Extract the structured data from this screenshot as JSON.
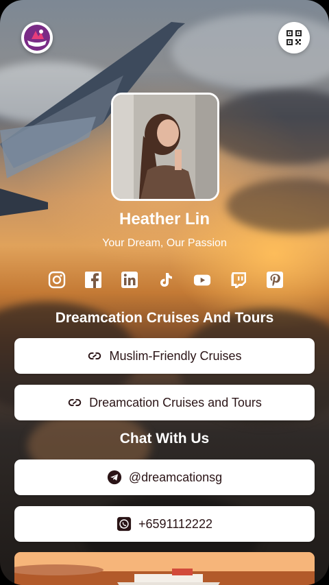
{
  "profile": {
    "name": "Heather Lin",
    "tagline": "Your Dream, Our Passion"
  },
  "header": {
    "logo_icon": "brand-logo",
    "qr_icon": "qr-code-icon"
  },
  "socials": [
    {
      "icon": "instagram-icon"
    },
    {
      "icon": "facebook-icon"
    },
    {
      "icon": "linkedin-icon"
    },
    {
      "icon": "tiktok-icon"
    },
    {
      "icon": "youtube-icon"
    },
    {
      "icon": "twitch-icon"
    },
    {
      "icon": "pinterest-icon"
    }
  ],
  "sections": {
    "links_title": "Dreamcation Cruises And Tours",
    "chat_title": "Chat With Us"
  },
  "links": [
    {
      "label": "Muslim-Friendly Cruises",
      "icon": "link-icon"
    },
    {
      "label": "Dreamcation Cruises and Tours",
      "icon": "link-icon"
    }
  ],
  "chat": [
    {
      "label": "@dreamcationsg",
      "icon": "telegram-icon"
    },
    {
      "label": "+6591112222",
      "icon": "whatsapp-icon"
    }
  ],
  "colors": {
    "button_bg": "#ffffff",
    "button_text": "#2a1416",
    "heading_text": "#ffffff"
  }
}
